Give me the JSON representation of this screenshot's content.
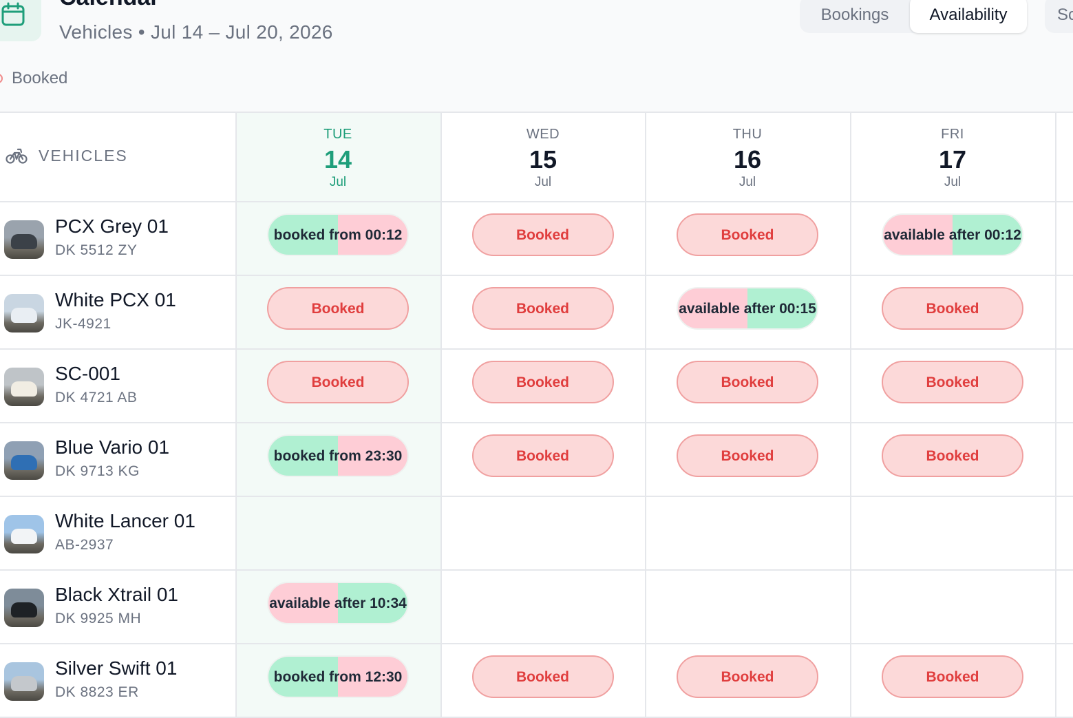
{
  "header": {
    "title": "Calendar",
    "subtitle": "Vehicles • Jul 14 – Jul 20, 2026",
    "legend": {
      "booked_label": "Booked"
    },
    "view_toggle": {
      "bookings": "Bookings",
      "availability": "Availability",
      "active": "availability"
    },
    "extra_button": "Sc"
  },
  "grid": {
    "vehicles_header": "VEHICLES",
    "days": [
      {
        "dow": "TUE",
        "date": "14",
        "month": "Jul",
        "today": true
      },
      {
        "dow": "WED",
        "date": "15",
        "month": "Jul",
        "today": false
      },
      {
        "dow": "THU",
        "date": "16",
        "month": "Jul",
        "today": false
      },
      {
        "dow": "FRI",
        "date": "17",
        "month": "Jul",
        "today": false
      }
    ],
    "vehicles": [
      {
        "name": "PCX Grey 01",
        "plate": "DK 5512 ZY",
        "thumb": "grey-scooter",
        "cells": [
          "booked from 00:12",
          "Booked",
          "Booked",
          "available after 00:12"
        ]
      },
      {
        "name": "White PCX 01",
        "plate": "JK-4921",
        "thumb": "white-scooter",
        "cells": [
          "Booked",
          "Booked",
          "available after 00:15",
          "Booked"
        ]
      },
      {
        "name": "SC-001",
        "plate": "DK 4721 AB",
        "thumb": "cream-scooter",
        "cells": [
          "Booked",
          "Booked",
          "Booked",
          "Booked"
        ]
      },
      {
        "name": "Blue Vario 01",
        "plate": "DK 9713 KG",
        "thumb": "blue-scooter",
        "cells": [
          "booked from 23:30",
          "Booked",
          "Booked",
          "Booked"
        ]
      },
      {
        "name": "White Lancer 01",
        "plate": "AB-2937",
        "thumb": "white-sedan",
        "cells": [
          "",
          "",
          "",
          ""
        ]
      },
      {
        "name": "Black Xtrail 01",
        "plate": "DK 9925 MH",
        "thumb": "black-suv",
        "cells": [
          "available after 10:34",
          "",
          "",
          ""
        ]
      },
      {
        "name": "Silver Swift 01",
        "plate": "DK 8823 ER",
        "thumb": "silver-hatchback",
        "cells": [
          "booked from 12:30",
          "Booked",
          "Booked",
          "Booked"
        ]
      }
    ]
  },
  "colors": {
    "accent": "#1e9e7a",
    "booked_bg": "#fcd9d9",
    "booked_text": "#e03e3e",
    "available_green": "#b0f0d2",
    "booked_pink": "#fecdd6"
  }
}
